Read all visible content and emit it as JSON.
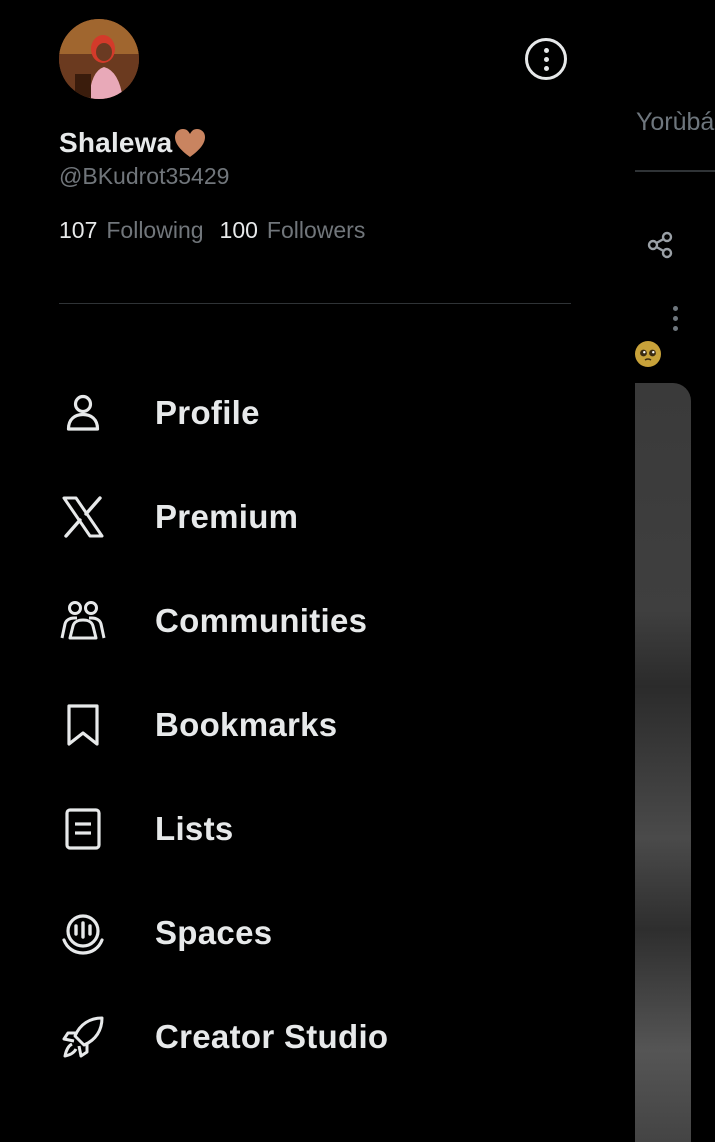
{
  "profile": {
    "display_name": "Shalewa",
    "handle": "@BKudrot35429",
    "following_count": "107",
    "following_label": "Following",
    "followers_count": "100",
    "followers_label": "Followers"
  },
  "menu": {
    "items": [
      {
        "label": "Profile",
        "icon": "person-icon"
      },
      {
        "label": "Premium",
        "icon": "x-logo-icon"
      },
      {
        "label": "Communities",
        "icon": "communities-icon"
      },
      {
        "label": "Bookmarks",
        "icon": "bookmark-icon"
      },
      {
        "label": "Lists",
        "icon": "list-icon"
      },
      {
        "label": "Spaces",
        "icon": "spaces-icon"
      },
      {
        "label": "Creator Studio",
        "icon": "rocket-icon"
      }
    ]
  },
  "background": {
    "language_tab": "Yorùbá"
  },
  "colors": {
    "background": "#000000",
    "text_primary": "#e7e9ea",
    "text_secondary": "#71767b",
    "divider": "#2f3336",
    "heart": "#c98460"
  }
}
